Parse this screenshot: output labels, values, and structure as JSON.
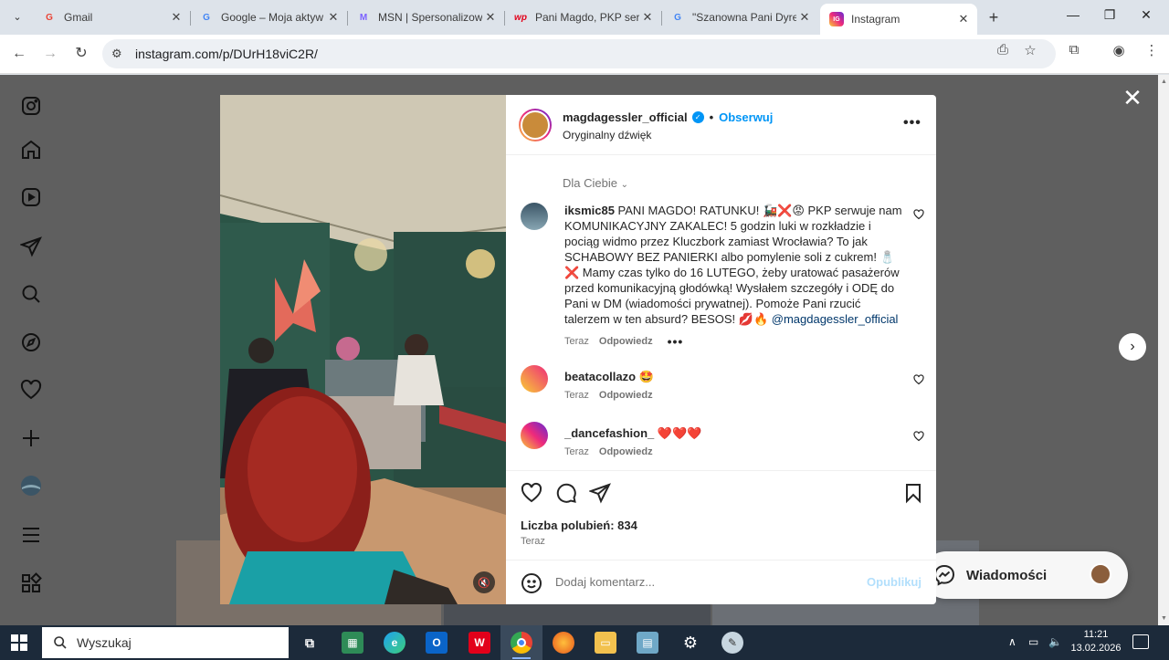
{
  "browser": {
    "tabs": [
      {
        "title": "Gmail",
        "favicon": "G",
        "color": "#ea4335"
      },
      {
        "title": "Google – Moja aktyw",
        "favicon": "G",
        "color": "#4285f4"
      },
      {
        "title": "MSN | Spersonalizow",
        "favicon": "M",
        "color": "#7b61ff"
      },
      {
        "title": "Pani Magdo, PKP ser",
        "favicon": "wp",
        "color": "#e2001a"
      },
      {
        "title": "\"Szanowna Pani Dyre",
        "favicon": "G",
        "color": "#4285f4"
      },
      {
        "title": "Instagram",
        "favicon": "IG",
        "color": "#d62976"
      }
    ],
    "url": "instagram.com/p/DUrH18viC2R/",
    "new_tab_label": "+"
  },
  "post": {
    "username": "magdagessler_official",
    "follow_label": "Obserwuj",
    "audio": "Oryginalny dźwięk",
    "for_you": "Dla Ciebie",
    "likes": "Liczba polubień: 834",
    "time": "Teraz",
    "add_comment_placeholder": "Dodaj komentarz...",
    "publish_label": "Opublikuj"
  },
  "comments": [
    {
      "user": "iksmic85",
      "text": " PANI MAGDO! RATUNKU! 🚂❌😡 PKP serwuje nam KOMUNIKACYJNY ZAKALEC! 5 godzin luki w rozkładzie i pociąg widmo przez Kluczbork zamiast Wrocławia? To jak SCHABOWY BEZ PANIERKI albo pomylenie soli z cukrem! 🧂❌ Mamy czas tylko do 16 LUTEGO, żeby uratować pasażerów przed komunikacyjną głodówką! Wysłałem szczegóły i ODĘ do Pani w DM (wiadomości prywatnej). Pomoże Pani rzucić talerzem w ten absurd? BESOS! 💋🔥 ",
      "mention": "@magdagessler_official",
      "time": "Teraz",
      "reply": "Odpowiedz"
    },
    {
      "user": "beatacollazo",
      "text": " 🤩",
      "time": "Teraz",
      "reply": "Odpowiedz"
    },
    {
      "user": "_dancefashion_",
      "text": " ❤️❤️❤️",
      "time": "Teraz",
      "reply": "Odpowiedz"
    }
  ],
  "messages_label": "Wiadomości",
  "taskbar": {
    "search_placeholder": "Wyszukaj",
    "time": "11:21",
    "date": "13.02.2026"
  }
}
